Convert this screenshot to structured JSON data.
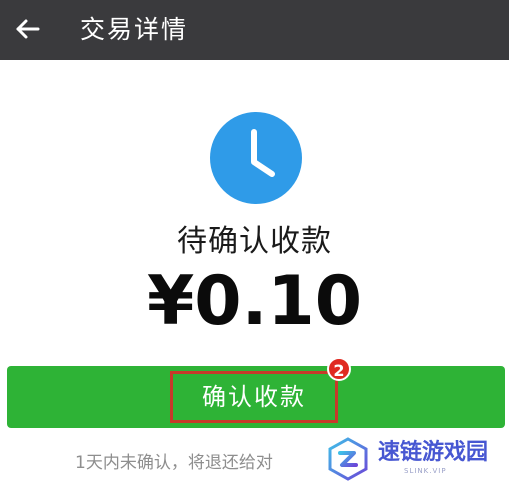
{
  "header": {
    "title": "交易详情",
    "back_icon": "arrow-left-icon"
  },
  "status": {
    "icon": "clock-icon",
    "icon_color": "#2f9be8",
    "text": "待确认收款",
    "amount": "¥0.10"
  },
  "actions": {
    "confirm_label": "确认收款",
    "confirm_color": "#2eb336",
    "highlight_color": "#c73a2a",
    "badge": "2"
  },
  "notice": "1天内未确认，将退还给对",
  "watermark": {
    "text": "速链游戏园",
    "subtext": "SLINK.VIP",
    "color": "#4757d2"
  }
}
